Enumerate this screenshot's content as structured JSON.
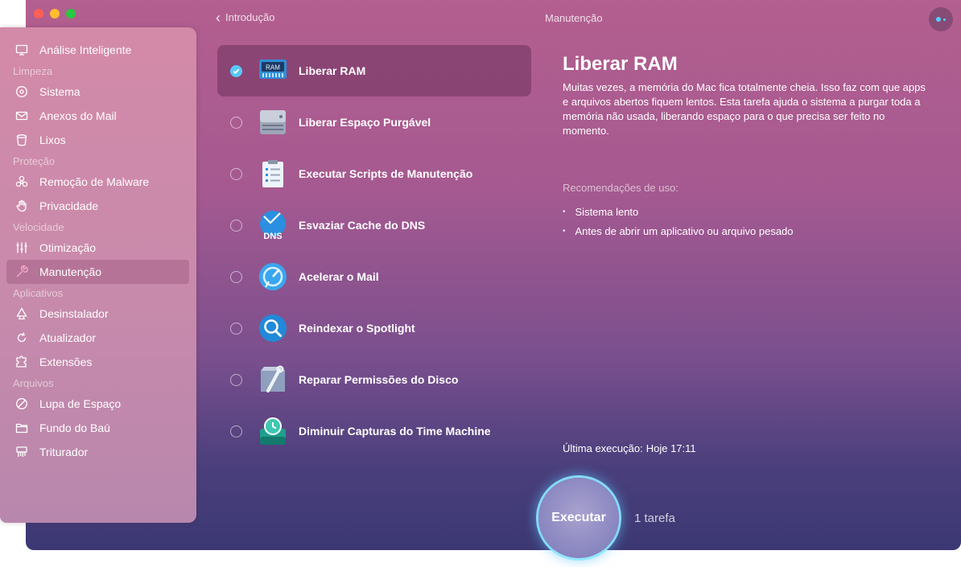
{
  "window": {
    "back_label": "Introdução",
    "title": "Manutenção"
  },
  "sidebar": {
    "top_item": {
      "label": "Análise Inteligente",
      "icon": "monitor-icon"
    },
    "sections": [
      {
        "title": "Limpeza",
        "items": [
          {
            "label": "Sistema",
            "icon": "disc-icon"
          },
          {
            "label": "Anexos do Mail",
            "icon": "envelope-icon"
          },
          {
            "label": "Lixos",
            "icon": "trash-icon"
          }
        ]
      },
      {
        "title": "Proteção",
        "items": [
          {
            "label": "Remoção de Malware",
            "icon": "biohazard-icon"
          },
          {
            "label": "Privacidade",
            "icon": "hand-icon"
          }
        ]
      },
      {
        "title": "Velocidade",
        "items": [
          {
            "label": "Otimização",
            "icon": "sliders-icon"
          },
          {
            "label": "Manutenção",
            "icon": "wrench-icon",
            "active": true
          }
        ]
      },
      {
        "title": "Aplicativos",
        "items": [
          {
            "label": "Desinstalador",
            "icon": "uninstaller-icon"
          },
          {
            "label": "Atualizador",
            "icon": "updater-icon"
          },
          {
            "label": "Extensões",
            "icon": "puzzle-icon"
          }
        ]
      },
      {
        "title": "Arquivos",
        "items": [
          {
            "label": "Lupa de Espaço",
            "icon": "space-lens-icon"
          },
          {
            "label": "Fundo do Baú",
            "icon": "folder-icon"
          },
          {
            "label": "Triturador",
            "icon": "shredder-icon"
          }
        ]
      }
    ]
  },
  "tasks": [
    {
      "label": "Liberar RAM",
      "icon": "ram-icon",
      "checked": true
    },
    {
      "label": "Liberar Espaço Purgável",
      "icon": "drive-icon",
      "checked": false
    },
    {
      "label": "Executar Scripts de Manutenção",
      "icon": "clipboard-icon",
      "checked": false
    },
    {
      "label": "Esvaziar Cache do DNS",
      "icon": "dns-icon",
      "checked": false
    },
    {
      "label": "Acelerar o Mail",
      "icon": "mail-speed-icon",
      "checked": false
    },
    {
      "label": "Reindexar o Spotlight",
      "icon": "spotlight-icon",
      "checked": false
    },
    {
      "label": "Reparar Permissões do Disco",
      "icon": "disk-repair-icon",
      "checked": false
    },
    {
      "label": "Diminuir Capturas do Time Machine",
      "icon": "time-machine-icon",
      "checked": false
    }
  ],
  "detail": {
    "title": "Liberar RAM",
    "description": "Muitas vezes, a memória do Mac fica totalmente cheia. Isso faz com que apps e arquivos abertos fiquem lentos. Esta tarefa ajuda o sistema a purgar toda a memória não usada, liberando espaço para o que precisa ser feito no momento.",
    "recommendations_title": "Recomendações de uso:",
    "recommendations": [
      "Sistema lento",
      "Antes de abrir um aplicativo ou arquivo pesado"
    ],
    "last_run_label": "Última execução:",
    "last_run_value": "Hoje 17:11"
  },
  "run": {
    "button_label": "Executar",
    "count_label": "1 tarefa"
  },
  "colors": {
    "accent": "#5ac8fa",
    "window_top": "#b35f8f",
    "window_bottom": "#3b3873"
  },
  "icons": {
    "ram_chip_text": "RAM",
    "dns_text": "DNS"
  }
}
